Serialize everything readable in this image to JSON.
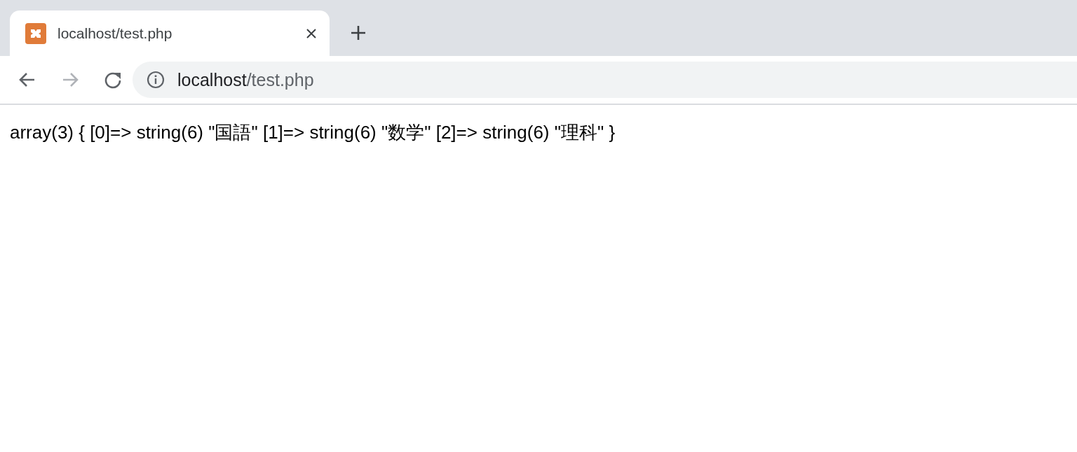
{
  "tabs": [
    {
      "title": "localhost/test.php",
      "selected": true
    }
  ],
  "nav": [
    {
      "kind": "back",
      "disabled": false
    },
    {
      "kind": "forward",
      "disabled": true
    },
    {
      "kind": "reload",
      "disabled": false
    }
  ],
  "address": {
    "host": "localhost",
    "path": "/test.php"
  },
  "content": "array(3) { [0]=> string(6) \"国語\" [1]=> string(6) \"数学\" [2]=> string(6) \"理科\" }"
}
